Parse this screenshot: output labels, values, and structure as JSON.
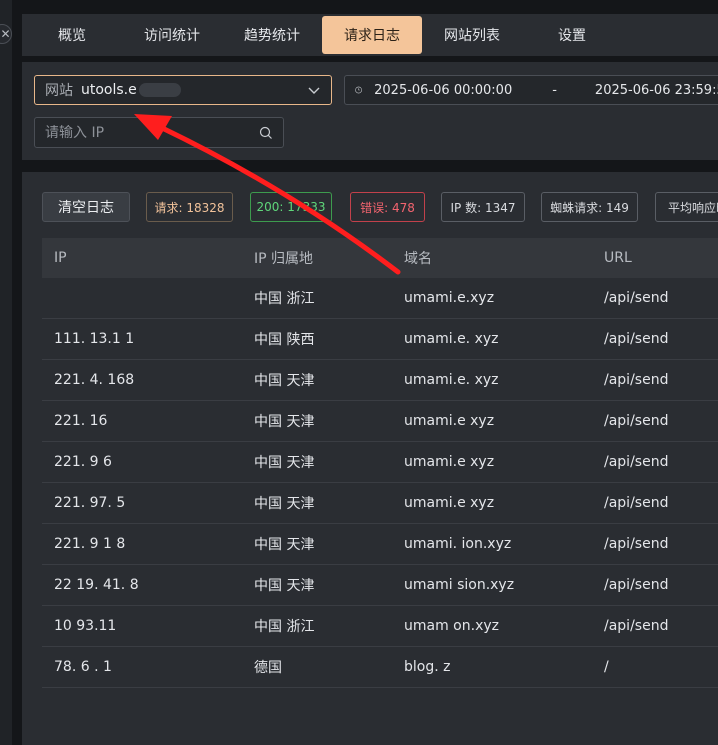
{
  "nav": {
    "tabs": [
      {
        "label": "概览"
      },
      {
        "label": "访问统计"
      },
      {
        "label": "趋势统计"
      },
      {
        "label": "请求日志"
      },
      {
        "label": "网站列表"
      },
      {
        "label": "设置"
      }
    ]
  },
  "filters": {
    "site_label": "网站",
    "site_value": "utools.e",
    "date_start": "2025-06-06 00:00:00",
    "date_sep": "-",
    "date_end": "2025-06-06 23:59:59",
    "ip_placeholder": "请输入 IP"
  },
  "actions": {
    "clear_label": "清空日志",
    "requests": "请求: 18328",
    "ok": "200: 17333",
    "errors": "错误: 478",
    "ip_count": "IP 数: 1347",
    "spider": "蜘蛛请求: 149",
    "avg_response": "平均响应时"
  },
  "table": {
    "headers": [
      "IP",
      "IP 归属地",
      "域名",
      "URL"
    ],
    "rows": [
      {
        "ip": "",
        "location": "中国 浙江",
        "domain": "umami.e.xyz",
        "url": "/api/send"
      },
      {
        "ip": "111. 13.1 1",
        "location": "中国 陕西",
        "domain": "umami.e. xyz",
        "url": "/api/send"
      },
      {
        "ip": "221. 4. 168",
        "location": "中国 天津",
        "domain": "umami.e. xyz",
        "url": "/api/send"
      },
      {
        "ip": "221. 16",
        "location": "中国 天津",
        "domain": "umami.e xyz",
        "url": "/api/send"
      },
      {
        "ip": "221. 9 6",
        "location": "中国 天津",
        "domain": "umami.e xyz",
        "url": "/api/send"
      },
      {
        "ip": "221. 97. 5",
        "location": "中国 天津",
        "domain": "umami.e xyz",
        "url": "/api/send"
      },
      {
        "ip": "221. 9 1 8",
        "location": "中国 天津",
        "domain": "umami. ion.xyz",
        "url": "/api/send"
      },
      {
        "ip": "22 19. 41. 8",
        "location": "中国 天津",
        "domain": "umami sion.xyz",
        "url": "/api/send"
      },
      {
        "ip": "10 93.11",
        "location": "中国 浙江",
        "domain": "umam on.xyz",
        "url": "/api/send"
      },
      {
        "ip": "78. 6 . 1",
        "location": "德国",
        "domain": "blog. z",
        "url": "/"
      }
    ]
  },
  "colors": {
    "accent": "#f4c59a",
    "ok": "#5fd67a",
    "error": "#f3646f",
    "arrow": "#ff1e1e"
  }
}
